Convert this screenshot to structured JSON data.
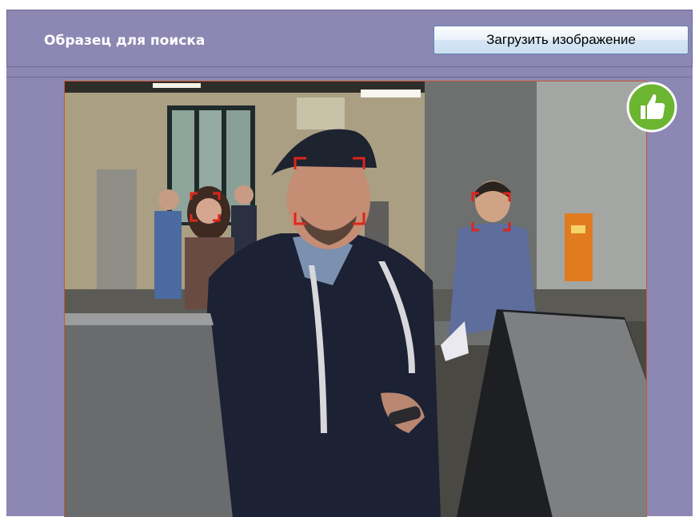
{
  "header": {
    "title": "Образец для поиска",
    "upload_button_label": "Загрузить изображение"
  },
  "preview": {
    "status_icon": "thumbs-up-icon",
    "status_color": "#6cb531",
    "face_marker_color": "#e0241b",
    "faces_detected": 3
  },
  "colors": {
    "panel_background": "#8c87b3",
    "button_border": "#5d86b2",
    "photo_border": "#c9582a"
  }
}
